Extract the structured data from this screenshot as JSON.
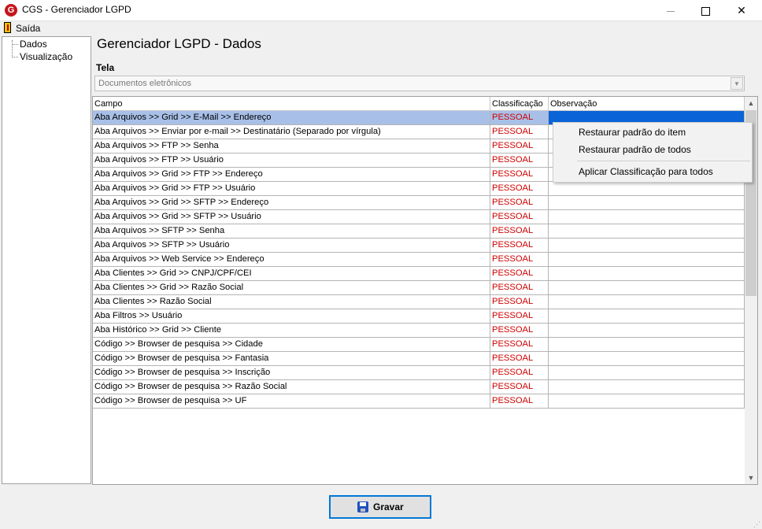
{
  "window": {
    "title": "CGS - Gerenciador LGPD",
    "app_icon": "G"
  },
  "menu": {
    "exit_label": "Saída"
  },
  "tree": {
    "items": [
      "Dados",
      "Visualização"
    ]
  },
  "page": {
    "title": "Gerenciador LGPD - Dados",
    "tela_label": "Tela"
  },
  "combo": {
    "value": "Documentos eletrônicos"
  },
  "grid": {
    "headers": {
      "campo": "Campo",
      "classificacao": "Classificação",
      "observacao": "Observação"
    },
    "rows": [
      {
        "campo": "Aba Arquivos  >> Grid >> E-Mail >> Endereço",
        "classificacao": "PESSOAL",
        "observacao": ""
      },
      {
        "campo": "Aba Arquivos >> Enviar por e-mail >> Destinatário (Separado por vírgula)",
        "classificacao": "PESSOAL",
        "observacao": ""
      },
      {
        "campo": "Aba Arquivos >> FTP >> Senha",
        "classificacao": "PESSOAL",
        "observacao": ""
      },
      {
        "campo": "Aba Arquivos >> FTP >> Usuário",
        "classificacao": "PESSOAL",
        "observacao": ""
      },
      {
        "campo": "Aba Arquivos >> Grid >> FTP >>  Endereço",
        "classificacao": "PESSOAL",
        "observacao": ""
      },
      {
        "campo": "Aba Arquivos >> Grid >> FTP >> Usuário",
        "classificacao": "PESSOAL",
        "observacao": ""
      },
      {
        "campo": "Aba Arquivos >> Grid >> SFTP >> Endereço",
        "classificacao": "PESSOAL",
        "observacao": ""
      },
      {
        "campo": "Aba Arquivos >> Grid >> SFTP >> Usuário",
        "classificacao": "PESSOAL",
        "observacao": ""
      },
      {
        "campo": "Aba Arquivos >> SFTP >> Senha",
        "classificacao": "PESSOAL",
        "observacao": ""
      },
      {
        "campo": "Aba Arquivos >> SFTP >> Usuário",
        "classificacao": "PESSOAL",
        "observacao": ""
      },
      {
        "campo": "Aba Arquivos >> Web Service >> Endereço",
        "classificacao": "PESSOAL",
        "observacao": ""
      },
      {
        "campo": "Aba Clientes >> Grid >> CNPJ/CPF/CEI",
        "classificacao": "PESSOAL",
        "observacao": ""
      },
      {
        "campo": "Aba Clientes >> Grid >> Razão Social",
        "classificacao": "PESSOAL",
        "observacao": ""
      },
      {
        "campo": "Aba Clientes >> Razão Social",
        "classificacao": "PESSOAL",
        "observacao": ""
      },
      {
        "campo": "Aba Filtros >> Usuário",
        "classificacao": "PESSOAL",
        "observacao": ""
      },
      {
        "campo": "Aba Histórico >> Grid >> Cliente",
        "classificacao": "PESSOAL",
        "observacao": ""
      },
      {
        "campo": "Código >> Browser de pesquisa >> Cidade",
        "classificacao": "PESSOAL",
        "observacao": ""
      },
      {
        "campo": "Código >> Browser de pesquisa >> Fantasia",
        "classificacao": "PESSOAL",
        "observacao": ""
      },
      {
        "campo": "Código >> Browser de pesquisa >> Inscrição",
        "classificacao": "PESSOAL",
        "observacao": ""
      },
      {
        "campo": "Código >> Browser de pesquisa >> Razão Social",
        "classificacao": "PESSOAL",
        "observacao": ""
      },
      {
        "campo": "Código >> Browser de pesquisa >> UF",
        "classificacao": "PESSOAL",
        "observacao": ""
      }
    ]
  },
  "context_menu": {
    "items": [
      "Restaurar padrão do item",
      "Restaurar padrão de todos",
      "Aplicar Classificação para todos"
    ]
  },
  "footer": {
    "save_label": "Gravar"
  },
  "colors": {
    "classification": "#d00000",
    "selection_row": "#a8c0e8",
    "selection_cell": "#0a64d8",
    "accent": "#0078d7"
  }
}
